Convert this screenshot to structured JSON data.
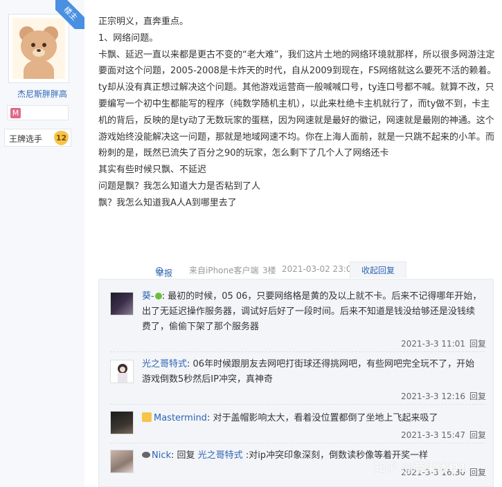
{
  "author": {
    "badge": "楼主",
    "name": "杰尼斯胖胖高",
    "level_icon": "M",
    "title_label": "王牌选手",
    "title_level": "12"
  },
  "post": {
    "lines": [
      "正宗明义，直奔重点。",
      "1、网络问题。",
      "卡飘、延迟一直以来都是更古不变的“老大难”，我们这片土地的网络环境就那样，所以很多网游注定要面对这个问题，2005-2008是卡炸天的时代，自从2009到现在，FS网络就这么要死不活的赖着。ty却从没有真正想过解决这个问题。其他游戏运营商一般喊喊口号，ty连口号都不喊。就算不改，只要编写一个初中生都能写的程序（纯数学随机主机），以此来杜绝卡主机就行了，而ty做不到，卡主机的背后，反映的是ty动了无数玩家的蛋糕，因为网速就是最好的徽记，网速就是最刚的神通。这个游戏始终没能解决这一问题，那就是地域网速不均。你在上海人面前，就是一只跳不起来的小羊。而粉刺的是，既然已流失了百分之90的玩家，怎么剩下了几个人了网络还卡",
      "其实有些时候只飘、不延迟",
      "问题是飘？我怎么知道大力是否粘到了人",
      "飘？我怎么知道我A人A到哪里去了"
    ],
    "report": "举报",
    "source": "来自iPhone客户端",
    "floor": "3楼",
    "datetime": "2021-03-02 23:03",
    "toggle_reply": "收起回复"
  },
  "replies": [
    {
      "name": "葵-",
      "text": ": 最初的时候，05 06，只要网络格是黄的及以上就不卡。后来不记得哪年开始，出了无延迟操作服务器，调试好后好了一段时间。后来不知道是钱没给够还是没钱续费了，偷偷下架了那个服务器",
      "time": "2021-3-3 11:01",
      "reply_btn": "回复"
    },
    {
      "name": "光之哥特式",
      "text": ": 06年时候跟朋友去网吧打街球还得挑网吧，有些网吧完全玩不了，开始游戏倒数5秒然后IP冲突，真神奇",
      "time": "2021-3-3 12:16",
      "reply_btn": "回复"
    },
    {
      "name": "Mastermind",
      "text": ": 对于盖帽影响太大，看着没位置都倒了坐地上飞起来吸了",
      "time": "2021-3-3 15:47",
      "reply_btn": "回复"
    },
    {
      "name": "Nick",
      "text_prefix": ": 回复 ",
      "reply_to": "光之哥特式",
      "text": " :对ip冲突印象深刻，倒数读秒像等着开奖一样",
      "time": "2021-3-3 16:30",
      "reply_btn": "回复"
    }
  ],
  "watermark": "知乎 @苹果冰Q1"
}
